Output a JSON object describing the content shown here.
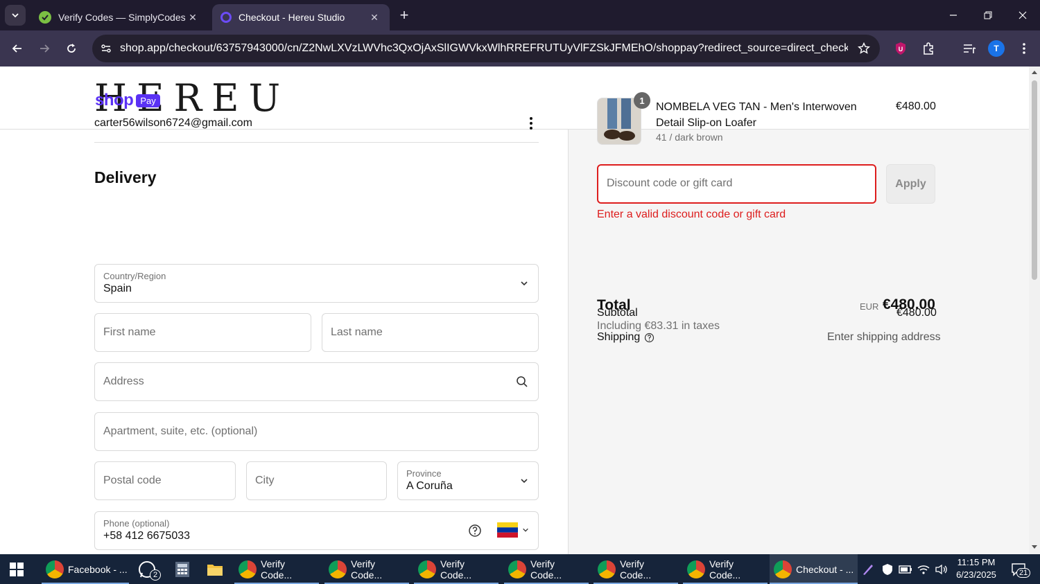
{
  "browser": {
    "tabs": [
      {
        "title": "Verify Codes — SimplyCodes",
        "active": false
      },
      {
        "title": "Checkout - Hereu Studio",
        "active": true
      }
    ],
    "url": "shop.app/checkout/63757943000/cn/Z2NwLXVzLWVhc3QxOjAxSlIGWVkxWlhRREFRUTUyVlFZSkJFMEhO/shoppay?redirect_source=direct_checkout_prod...",
    "profile_initial": "T"
  },
  "page": {
    "logo": "HEREU",
    "shoppay": {
      "shop": "shop",
      "pay": "Pay"
    },
    "email": "carter56wilson6724@gmail.com",
    "delivery_heading": "Delivery",
    "fields": {
      "country_label": "Country/Region",
      "country_value": "Spain",
      "first_name": "First name",
      "last_name": "Last name",
      "address": "Address",
      "apartment": "Apartment, suite, etc. (optional)",
      "postal_code": "Postal code",
      "city": "City",
      "province_label": "Province",
      "province_value": "A Coruña",
      "phone_label": "Phone (optional)",
      "phone_value": "+58 412 6675033"
    },
    "order": {
      "qty": "1",
      "product_name": "NOMBELA VEG TAN - Men's Interwoven Detail Slip-on Loafer",
      "variant": "41 / dark brown",
      "price": "€480.00",
      "discount_placeholder": "Discount code or gift card",
      "apply_label": "Apply",
      "error": "Enter a valid discount code or gift card",
      "subtotal_label": "Subtotal",
      "subtotal_value": "€480.00",
      "shipping_label": "Shipping",
      "shipping_value": "Enter shipping address",
      "total_label": "Total",
      "total_currency": "EUR",
      "total_value": "€480.00",
      "tax_note": "Including €83.31 in taxes"
    }
  },
  "taskbar": {
    "items": [
      {
        "label": "Facebook - ..."
      },
      {
        "label": "2"
      },
      {
        "label": "Verify Code..."
      },
      {
        "label": "Verify Code..."
      },
      {
        "label": "Verify Code..."
      },
      {
        "label": "Verify Code..."
      },
      {
        "label": "Verify Code..."
      },
      {
        "label": "Verify Code..."
      },
      {
        "label": "Checkout - ..."
      }
    ],
    "time": "11:15 PM",
    "date": "6/23/2025",
    "notifications": "21"
  },
  "colors": {
    "shop_purple": "#5a31f4",
    "error_red": "#dd1d1d",
    "tab_bar": "#1f1b2e",
    "toolbar": "#3a3550",
    "taskbar": "#16243a"
  }
}
